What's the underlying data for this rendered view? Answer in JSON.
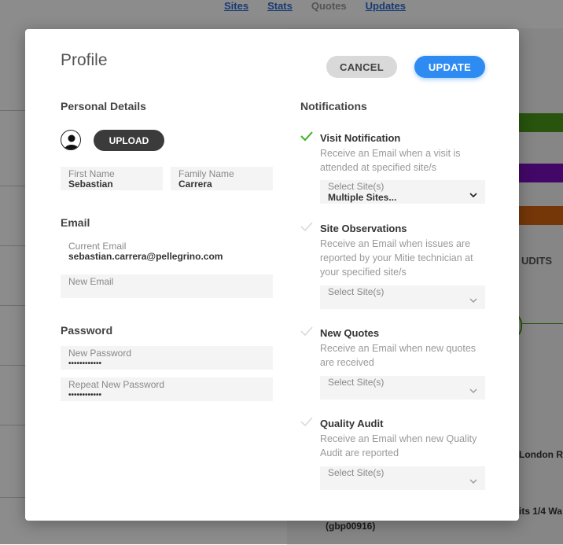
{
  "background": {
    "nav": [
      "Sites",
      "Stats",
      "Quotes",
      "Updates"
    ],
    "audits_label": "UDITS",
    "site_text_1": "London Ro",
    "site_text_2": "its 1/4 Wa",
    "site_code": "(gbp00916)"
  },
  "modal": {
    "title": "Profile",
    "cancel_label": "CANCEL",
    "update_label": "UPDATE",
    "personal": {
      "heading": "Personal Details",
      "upload_label": "UPLOAD",
      "first_name_label": "First Name",
      "first_name_value": "Sebastian",
      "family_name_label": "Family Name",
      "family_name_value": "Carrera"
    },
    "email": {
      "heading": "Email",
      "current_label": "Current Email",
      "current_value": "sebastian.carrera@pellegrino.com",
      "new_label": "New Email"
    },
    "password": {
      "heading": "Password",
      "new_label": "New Password",
      "new_value": "••••••••••••",
      "repeat_label": "Repeat New Password",
      "repeat_value": "••••••••••••"
    },
    "notifications": {
      "heading": "Notifications",
      "items": [
        {
          "title": "Visit Notification",
          "description": "Receive an Email when a visit is attended at specified site/s",
          "checked": true,
          "select_label": "Select Site(s)",
          "select_value": "Multiple Sites..."
        },
        {
          "title": "Site Observations",
          "description": "Receive an Email when issues are reported by your Mitie technician at your specified site/s",
          "checked": false,
          "select_label": "Select Site(s)",
          "select_value": ""
        },
        {
          "title": "New Quotes",
          "description": "Receive an Email when new quotes are received",
          "checked": false,
          "select_label": "Select Site(s)",
          "select_value": ""
        },
        {
          "title": "Quality Audit",
          "description": "Receive an Email when new Quality Audit are reported",
          "checked": false,
          "select_label": "Select Site(s)",
          "select_value": ""
        }
      ]
    }
  },
  "colors": {
    "primary": "#2d8bf2",
    "check_on": "#3fae2a",
    "check_off": "#d8d8d8",
    "upload_bg": "#3b3b3b"
  }
}
